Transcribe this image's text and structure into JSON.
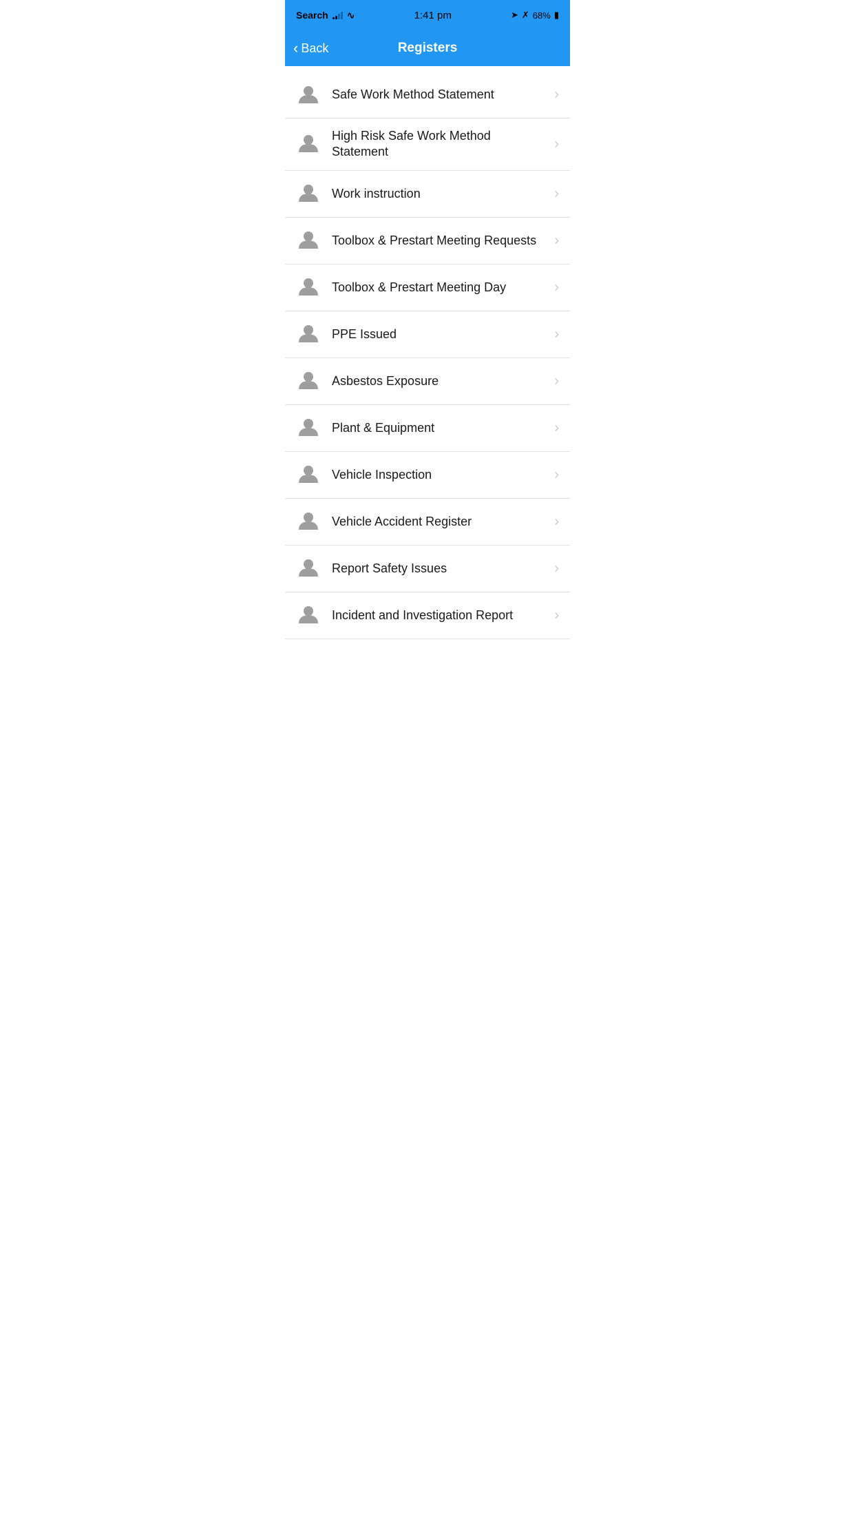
{
  "statusBar": {
    "appName": "Search",
    "time": "1:41 pm",
    "battery": "68%",
    "batteryColor": "#000000"
  },
  "navBar": {
    "backLabel": "Back",
    "title": "Registers"
  },
  "listItems": [
    {
      "id": "safe-work-method-statement",
      "label": "Safe Work Method Statement"
    },
    {
      "id": "high-risk-safe-work-method-statement",
      "label": "High Risk Safe Work Method Statement"
    },
    {
      "id": "work-instruction",
      "label": "Work instruction"
    },
    {
      "id": "toolbox-prestart-meeting-requests",
      "label": "Toolbox & Prestart Meeting Requests"
    },
    {
      "id": "toolbox-prestart-meeting-day",
      "label": "Toolbox & Prestart Meeting Day"
    },
    {
      "id": "ppe-issued",
      "label": "PPE Issued"
    },
    {
      "id": "asbestos-exposure",
      "label": "Asbestos Exposure"
    },
    {
      "id": "plant-equipment",
      "label": "Plant & Equipment"
    },
    {
      "id": "vehicle-inspection",
      "label": "Vehicle Inspection"
    },
    {
      "id": "vehicle-accident-register",
      "label": "Vehicle Accident Register"
    },
    {
      "id": "report-safety-issues",
      "label": "Report Safety Issues"
    },
    {
      "id": "incident-investigation-report",
      "label": "Incident and Investigation Report"
    }
  ]
}
